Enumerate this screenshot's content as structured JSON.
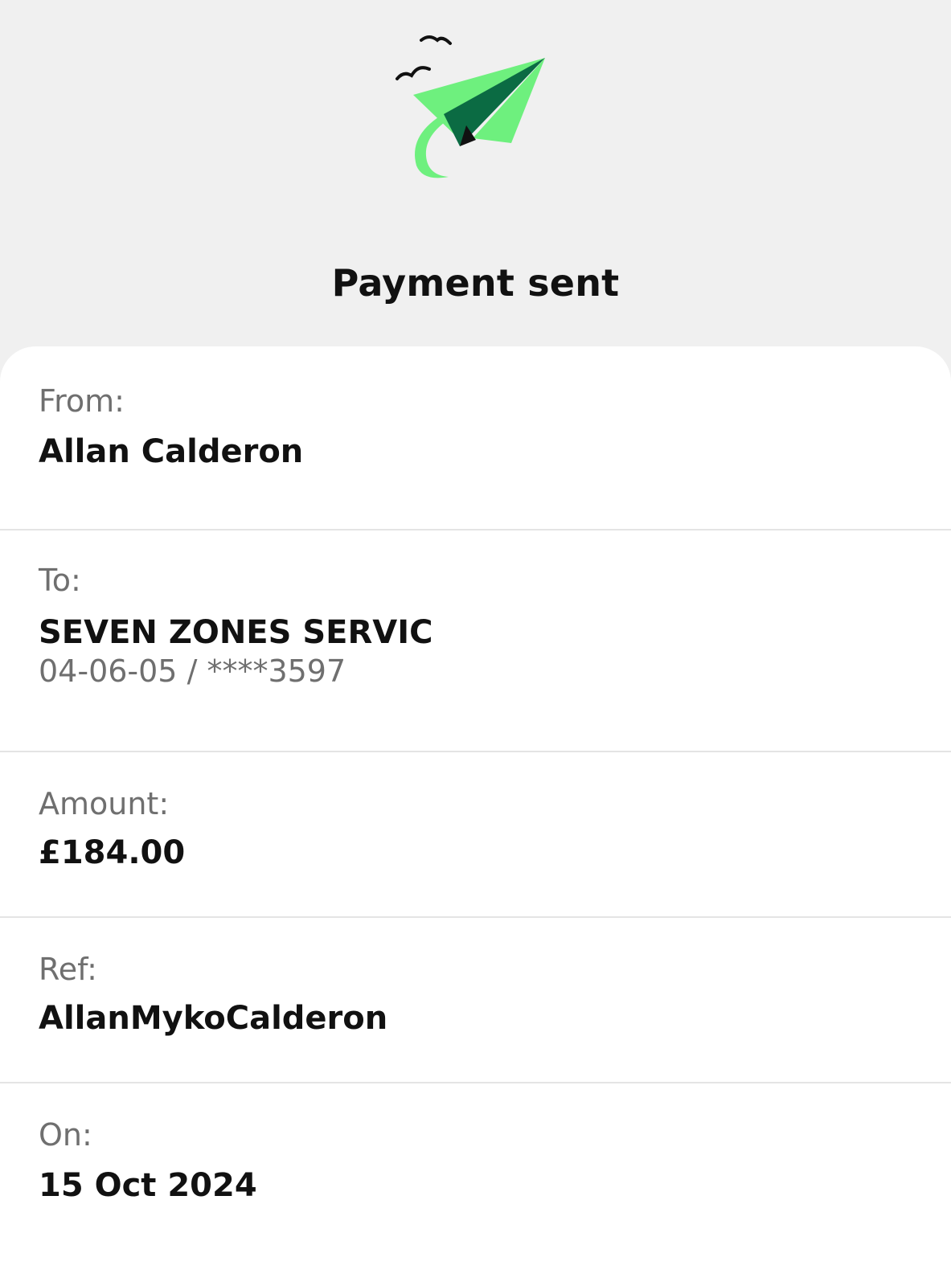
{
  "header": {
    "title": "Payment sent",
    "icon": "paper-plane-icon",
    "accent_color": "#6ef07e",
    "dark_color": "#0b6b43"
  },
  "details": {
    "from": {
      "label": "From:",
      "value": "Allan Calderon"
    },
    "to": {
      "label": "To:",
      "value": "SEVEN ZONES SERVIC",
      "account": "04-06-05 / ****3597"
    },
    "amount": {
      "label": "Amount:",
      "value": "£184.00"
    },
    "ref": {
      "label": "Ref:",
      "value": "AllanMykoCalderon"
    },
    "on": {
      "label": "On:",
      "value": "15 Oct 2024"
    }
  }
}
